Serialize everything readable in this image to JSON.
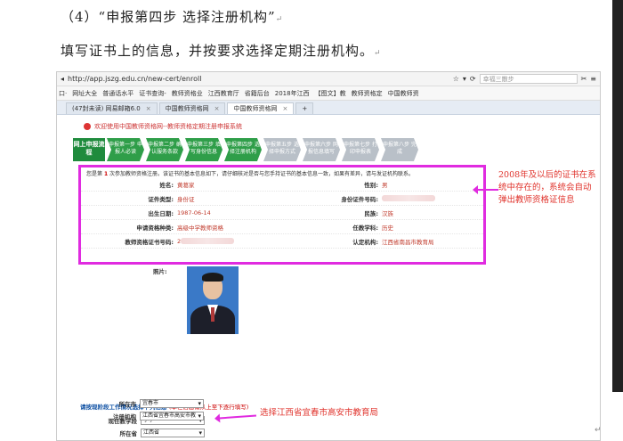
{
  "doc": {
    "heading": "（4）“申报第四步 选择注册机构”",
    "line": "填写证书上的信息，并按要求选择定期注册机构。",
    "return_mark": "↵"
  },
  "browser": {
    "url": "http://app.jszg.edu.cn/new-cert/enroll",
    "search_placeholder": "幸福三散步",
    "bookmarks": [
      "口·",
      "网址大全",
      "普通话水平",
      "证书查询-",
      "教师资格业",
      "江西教育厅",
      "省籍后台",
      "2018年江西",
      "【图文】教",
      "教师资格定",
      "中国教师资"
    ],
    "tabs": [
      {
        "label": "(47封未读) 网易邮箱6.0"
      },
      {
        "label": "中国教师资格网"
      },
      {
        "label": "中国教师资格网",
        "active": true
      }
    ],
    "new_tab": "+"
  },
  "page": {
    "site_title": "欢迎使用中国教师资格网--教师资格定期注册申报系统",
    "step_main": "网上申报流程",
    "steps": [
      {
        "label": "申报第一步 申报人必读",
        "done": true
      },
      {
        "label": "申报第二步 确认服务条款",
        "done": true
      },
      {
        "label": "申报第三步 填写身份信息",
        "done": true
      },
      {
        "label": "申报第四步 选择注册机构",
        "done": true
      },
      {
        "label": "申报第五步 选择申报方式",
        "done": false
      },
      {
        "label": "申报第六步 网报信息填写",
        "done": false
      },
      {
        "label": "申报第七步 打印申报表",
        "done": false
      },
      {
        "label": "申报第八步 完成",
        "done": false
      }
    ],
    "info_note_pre": "您是第",
    "info_note_num": "1",
    "info_note_post": "次参加教师资格注册。该证书的基本信息如下，请仔细核对是否与您手持证书的基本信息一致，如果有差异，请与发证机构联系。",
    "fields": {
      "name_label": "姓名:",
      "name": "黄葛家",
      "gender_label": "性别:",
      "gender": "男",
      "id_type_label": "证件类型:",
      "id_type": "身份证",
      "id_no_label": "身份证件号码:",
      "birth_label": "出生日期:",
      "birth": "1987-06-14",
      "nation_label": "民族:",
      "nation": "汉族",
      "cert_type_label": "申请资格种类:",
      "cert_type": "高级中学教师资格",
      "subject_label": "任教学科:",
      "subject": "历史",
      "cert_no_label": "教师资格证书号码:",
      "cert_no": "2",
      "authority_label": "认定机构:",
      "authority": "江西省南昌市教育局",
      "photo_label": "照片:"
    },
    "form_head": "请按现阶段工作情况选择下列信息",
    "form_head_note": "(本栏信息请从上至下逐行填写)",
    "form": {
      "stage_label": "现任教学段",
      "stage": "小学",
      "province_label": "所在省",
      "province": "江西省",
      "city_label": "所在市",
      "city": "宜春市",
      "org_label": "注册机构",
      "org": "江西省宜春市高安市教"
    }
  },
  "annotations": {
    "right": "2008年及以后的证书在系统中存在的，系统会自动弹出教师资格证信息",
    "bottom": "选择江西省宜春市高安市教育局"
  },
  "colors": {
    "highlight": "#e02be0",
    "annotation_text": "#e0342d",
    "step_done": "#2f9e49",
    "step_todo": "#b9c0c8"
  }
}
